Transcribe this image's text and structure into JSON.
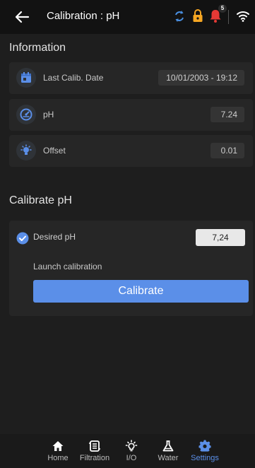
{
  "header": {
    "title": "Calibration : pH",
    "notification_count": "5",
    "colors": {
      "sync": "#4a90e2",
      "lock": "#f5a623",
      "bell": "#e53935"
    }
  },
  "information": {
    "title": "Information",
    "rows": [
      {
        "icon": "calendar-icon",
        "label": "Last Calib. Date",
        "value": "10/01/2003 - 19:12"
      },
      {
        "icon": "gauge-icon",
        "label": "pH",
        "value": "7.24"
      },
      {
        "icon": "bulb-icon",
        "label": "Offset",
        "value": "0.01"
      }
    ]
  },
  "calibrate": {
    "title": "Calibrate pH",
    "desired_label": "Desired pH",
    "desired_value": "7,24",
    "launch_label": "Launch calibration",
    "button_label": "Calibrate"
  },
  "nav": {
    "items": [
      {
        "label": "Home",
        "icon": "home-icon"
      },
      {
        "label": "Filtration",
        "icon": "filtration-icon"
      },
      {
        "label": "I/O",
        "icon": "io-icon"
      },
      {
        "label": "Water",
        "icon": "flask-icon"
      },
      {
        "label": "Settings",
        "icon": "gear-icon",
        "active": true
      }
    ]
  },
  "accent": "#5b8fe8"
}
